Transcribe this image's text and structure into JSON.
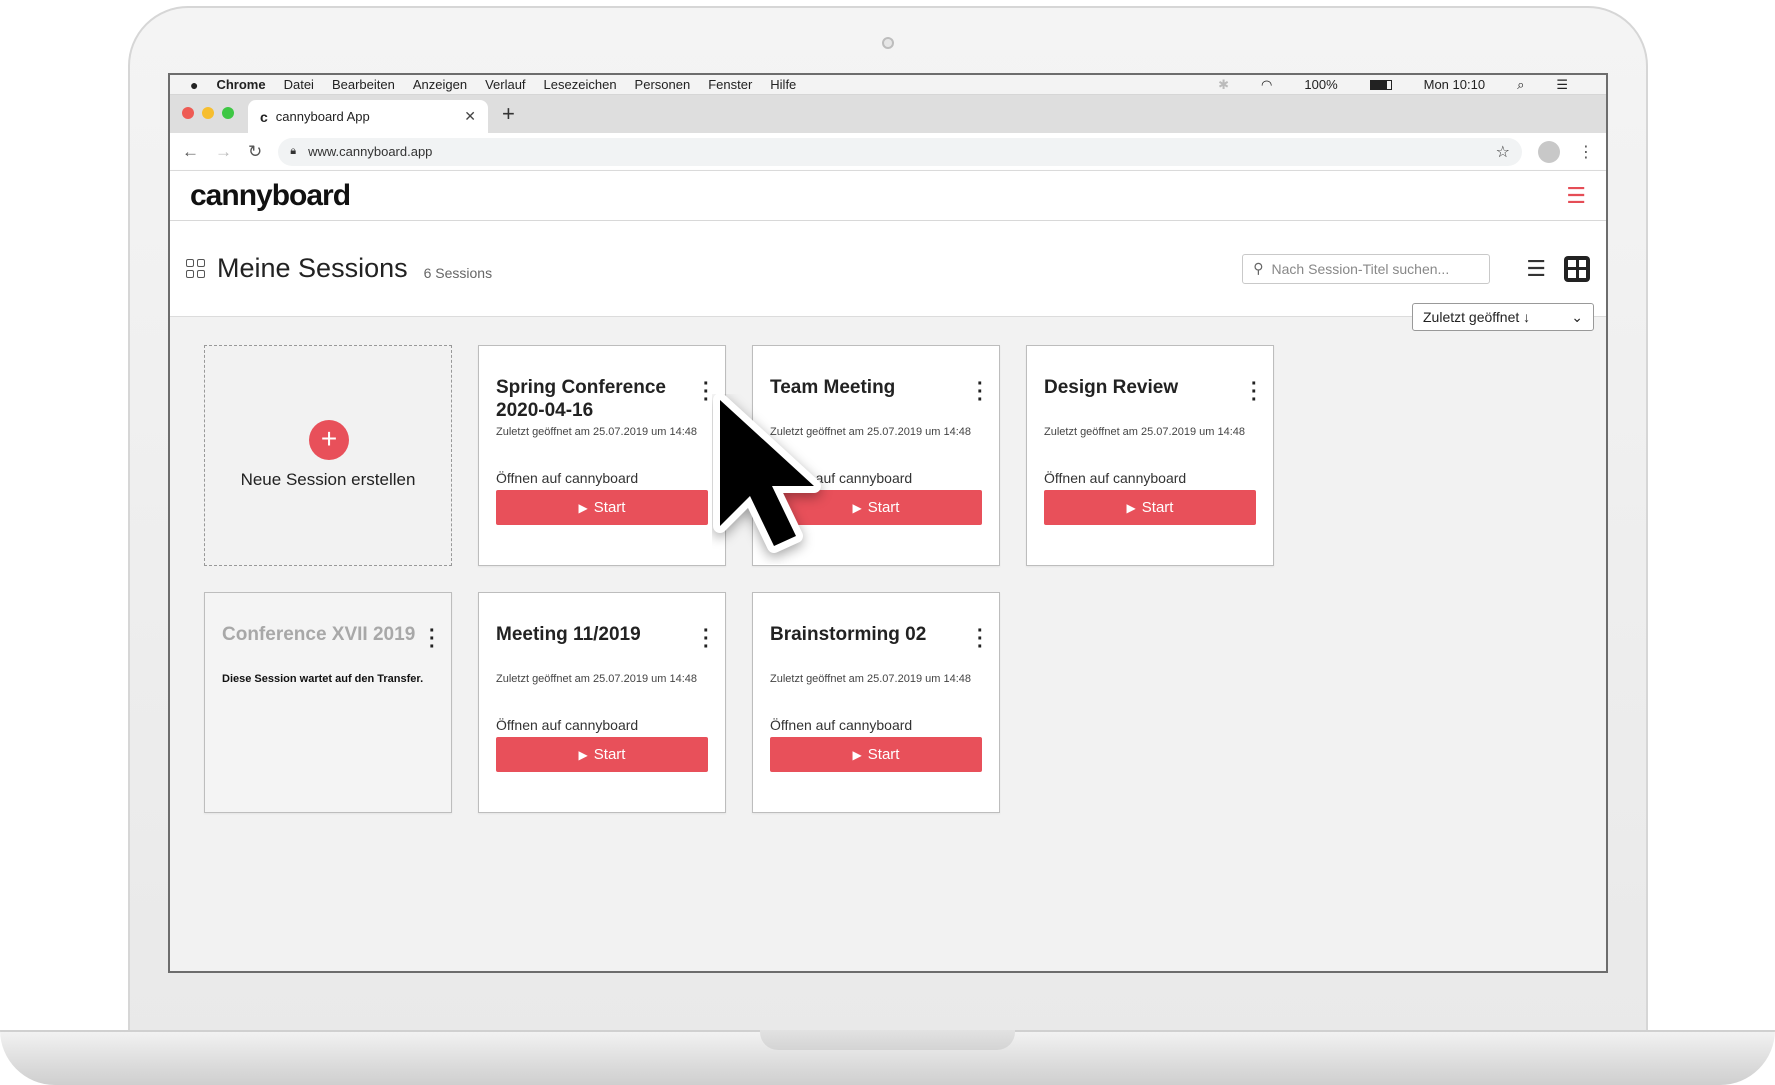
{
  "menubar": {
    "apple": "",
    "app": "Chrome",
    "items": [
      "Datei",
      "Bearbeiten",
      "Anzeigen",
      "Verlauf",
      "Lesezeichen",
      "Personen",
      "Fenster",
      "Hilfe"
    ],
    "battery": "100%",
    "clock": "Mon 10:10"
  },
  "browser": {
    "tab_title": "cannyboard App",
    "tab_favicon": "c",
    "url": "www.cannyboard.app"
  },
  "app": {
    "logo": "cannyboard"
  },
  "sessions": {
    "title": "Meine Sessions",
    "count": "6 Sessions",
    "search_placeholder": "Nach Session-Titel suchen...",
    "sort_label": "Zuletzt geöffnet ↓",
    "new_session": "Neue Session erstellen"
  },
  "cards": [
    {
      "title": "Spring Conference 2020-04-16",
      "meta": "Zuletzt geöffnet am 25.07.2019 um 14:48",
      "open": "Öffnen auf cannyboard",
      "button": "Start"
    },
    {
      "title": "Team Meeting",
      "meta": "Zuletzt geöffnet am 25.07.2019 um 14:48",
      "open": "Öffnen auf cannyboard",
      "button": "Start"
    },
    {
      "title": "Design Review",
      "meta": "Zuletzt geöffnet am 25.07.2019 um 14:48",
      "open": "Öffnen auf cannyboard",
      "button": "Start"
    },
    {
      "title": "Conference XVII 2019",
      "wait": "Diese Session wartet auf den Transfer."
    },
    {
      "title": "Meeting 11/2019",
      "meta": "Zuletzt geöffnet am 25.07.2019 um 14:48",
      "open": "Öffnen auf cannyboard",
      "button": "Start"
    },
    {
      "title": "Brainstorming 02",
      "meta": "Zuletzt geöffnet am 25.07.2019 um 14:48",
      "open": "Öffnen auf cannyboard",
      "button": "Start"
    }
  ],
  "colors": {
    "accent": "#e8505a",
    "pending_title": "#a8a8a8"
  },
  "icons": {
    "menu": "hamburger-icon",
    "search": "search-icon",
    "list": "list-view-icon",
    "grid": "grid-view-icon",
    "cursor": "mouse-pointer-icon"
  }
}
